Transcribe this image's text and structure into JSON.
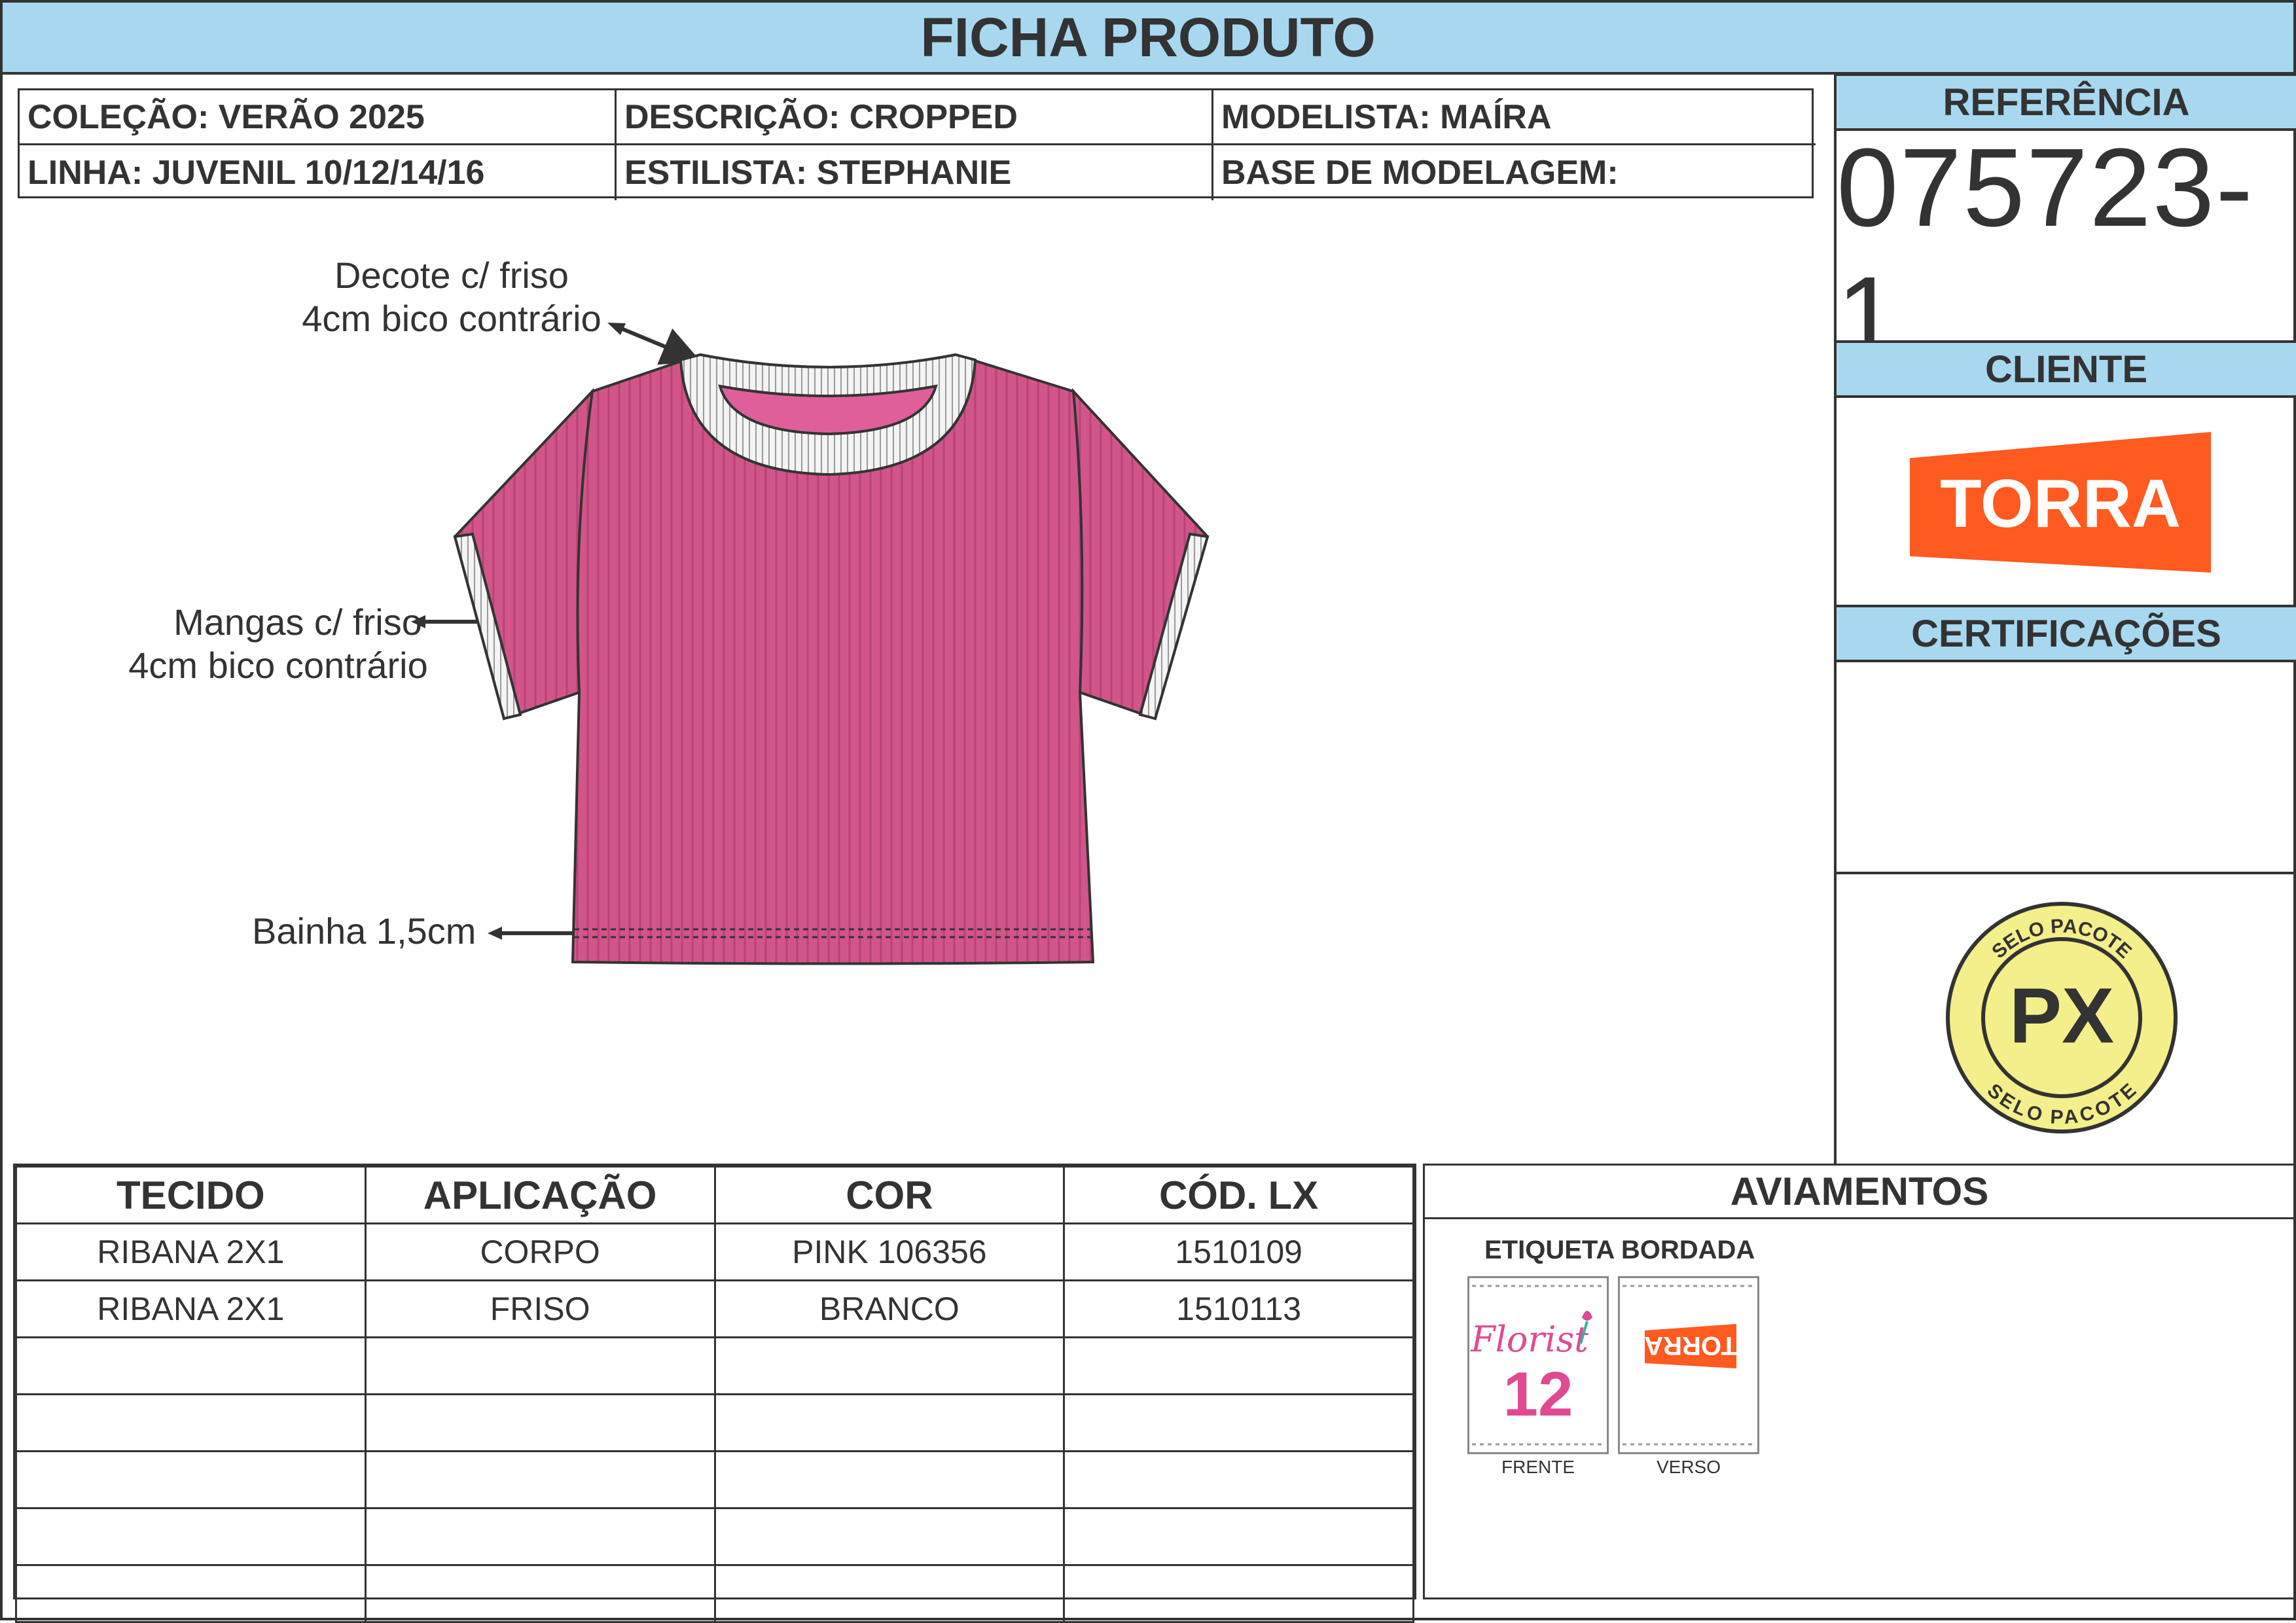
{
  "header": {
    "title": "FICHA PRODUTO"
  },
  "info": {
    "colecao": "COLEÇÃO: VERÃO 2025",
    "descricao": "DESCRIÇÃO: CROPPED",
    "modelista": "MODELISTA: MAÍRA",
    "linha": "LINHA: JUVENIL 10/12/14/16",
    "estilista": "ESTILISTA: STEPHANIE",
    "base": "BASE DE MODELAGEM:"
  },
  "referencia": {
    "label": "REFERÊNCIA",
    "value": "075723-1"
  },
  "cliente": {
    "label": "CLIENTE",
    "logo_text": "TORRA",
    "logo_color": "#ff5a1f"
  },
  "certificacoes": {
    "label": "CERTIFICAÇÕES"
  },
  "selo": {
    "top_text": "SELO PACOTE",
    "bottom_text": "SELO PACOTE",
    "center": "PX",
    "color": "#f3ef8a"
  },
  "annotations": {
    "decote_1": "Decote c/ friso",
    "decote_2": "4cm bico contrário",
    "mangas_1": "Mangas c/ friso",
    "mangas_2": "4cm bico contrário",
    "bainha": "Bainha 1,5cm"
  },
  "garment": {
    "body_color": "#d2558a",
    "rib_color": "#f4f4f4"
  },
  "fabric_table": {
    "headers": [
      "TECIDO",
      "APLICAÇÃO",
      "COR",
      "CÓD. LX"
    ],
    "rows": [
      [
        "RIBANA 2X1",
        "CORPO",
        "PINK 106356",
        "1510109"
      ],
      [
        "RIBANA 2X1",
        "FRISO",
        "BRANCO",
        "1510113"
      ],
      [
        "",
        "",
        "",
        ""
      ],
      [
        "",
        "",
        "",
        ""
      ],
      [
        "",
        "",
        "",
        ""
      ],
      [
        "",
        "",
        "",
        ""
      ],
      [
        "",
        "",
        "",
        ""
      ]
    ]
  },
  "aviamentos": {
    "title": "AVIAMENTOS",
    "etiqueta_title": "ETIQUETA BORDADA",
    "front_brand": "Florist",
    "front_size": "12",
    "back_brand": "TORRA",
    "front_caption": "FRENTE",
    "back_caption": "VERSO"
  }
}
